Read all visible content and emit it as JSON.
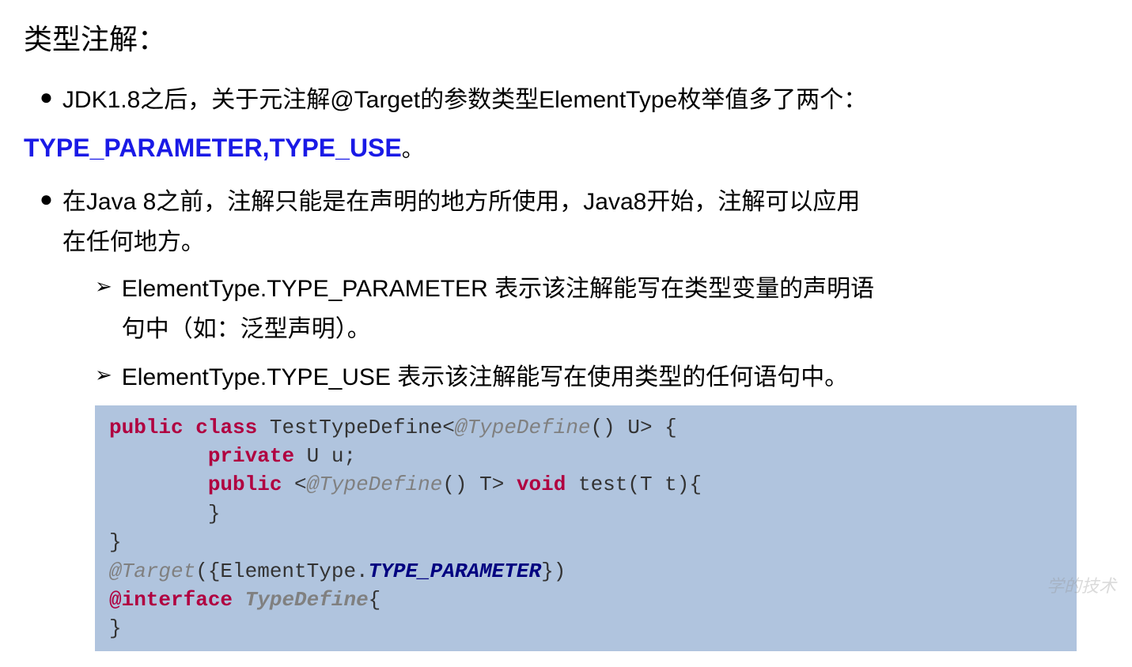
{
  "title": "类型注解：",
  "bullet1_text": "JDK1.8之后，关于元注解@Target的参数类型ElementType枚举值多了两个：",
  "highlight": "TYPE_PARAMETER,TYPE_USE",
  "period": "。",
  "bullet2_line1": "在Java 8之前，注解只能是在声明的地方所使用，Java8开始，注解可以应用",
  "bullet2_line2": "在任何地方。",
  "sub1_line1": "ElementType.TYPE_PARAMETER 表示该注解能写在类型变量的声明语",
  "sub1_line2": "句中（如：泛型声明）。",
  "sub2_line1": "ElementType.TYPE_USE 表示该注解能写在使用类型的任何语句中。",
  "code": {
    "kw_public": "public",
    "kw_class": "class",
    "cls_name": "TestTypeDefine",
    "ann_typedef": "@TypeDefine",
    "paren_u": "() U> {",
    "kw_private": "private",
    "u_decl": " U u;",
    "paren_t": "() T> ",
    "kw_void": "void",
    "test": " test(T t){",
    "close1": "}",
    "close2": "}",
    "ann_target": "@Target",
    "target_arg1": "({ElementType.",
    "const_tp": "TYPE_PARAMETER",
    "target_arg2": "})",
    "kw_atinterface": "@interface",
    "cls_typedef": "TypeDefine",
    "open_br": "{",
    "close3": "}"
  },
  "watermark": "学的技术"
}
